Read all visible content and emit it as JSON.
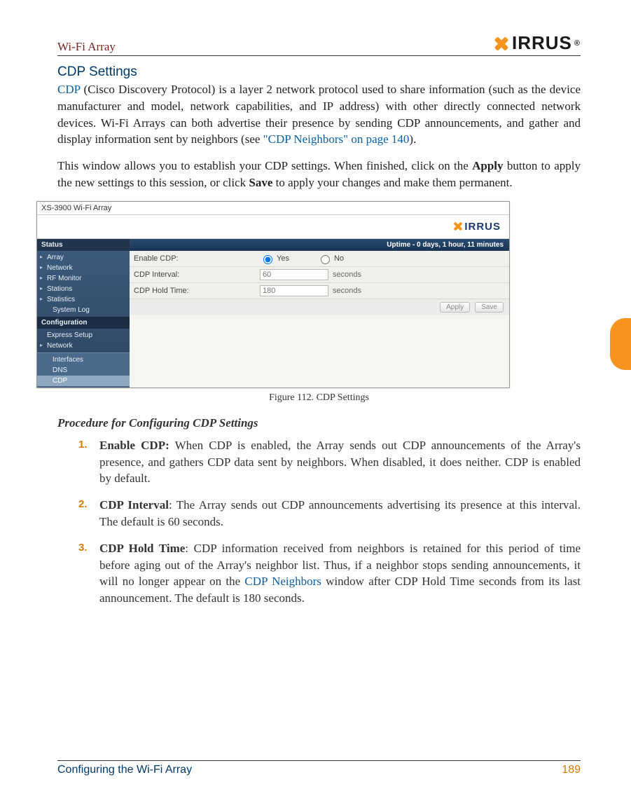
{
  "header": {
    "left": "Wi-Fi Array",
    "logo_text": "IRRUS",
    "logo_reg": "®"
  },
  "section_title": "CDP Settings",
  "p1": {
    "acronym": "CDP",
    "text1": " (Cisco Discovery Protocol) is a layer 2 network protocol used to share information (such as the device manufacturer and model, network capabilities, and IP address) with other directly connected network devices. Wi-Fi Arrays can both advertise their presence by sending CDP announcements, and gather and display information sent by neighbors (see ",
    "link": "\"CDP Neighbors\" on page 140",
    "text2": ")."
  },
  "p2": {
    "t1": "This window allows you to establish your CDP settings. When finished, click on the ",
    "b1": "Apply",
    "t2": " button to apply the new settings to this session, or click ",
    "b2": "Save",
    "t3": " to apply your changes and make them permanent."
  },
  "figure_caption": "Figure 112. CDP Settings",
  "procedure_title": "Procedure for Configuring CDP Settings",
  "steps": [
    {
      "num": "1.",
      "title": "Enable CDP:",
      "body": " When CDP is enabled, the Array sends out CDP announcements of the Array's presence, and gathers CDP data sent by neighbors. When disabled, it does neither. CDP is enabled by default."
    },
    {
      "num": "2.",
      "title": "CDP Interval",
      "body": ": The Array sends out CDP announcements advertising its presence at this interval. The default is 60 seconds."
    },
    {
      "num": "3.",
      "title": "CDP Hold Time",
      "body_pre": ": CDP information received from neighbors is retained for this period of time before aging out of the Array's neighbor list. Thus, if a neighbor stops sending announcements, it will no longer appear on the ",
      "link": "CDP Neighbors",
      "body_post": " window after CDP Hold Time seconds from its last announcement. The default is 180 seconds."
    }
  ],
  "footer": {
    "left": "Configuring the Wi-Fi Array",
    "page": "189"
  },
  "screenshot": {
    "titlebar": "XS-3900 Wi-Fi Array",
    "mini_logo": "IRRUS",
    "status_label": "Status",
    "uptime": "Uptime - 0 days, 1 hour, 11 minutes",
    "nav": [
      "Array",
      "Network",
      "RF Monitor",
      "Stations",
      "Statistics"
    ],
    "nav_syslog": "System Log",
    "config_label": "Configuration",
    "config_items": [
      "Express Setup",
      "Network"
    ],
    "sub_items": [
      "Interfaces",
      "DNS",
      "CDP"
    ],
    "row1": {
      "label": "Enable CDP:",
      "yes": "Yes",
      "no": "No"
    },
    "row2": {
      "label": "CDP Interval:",
      "value": "60",
      "unit": "seconds"
    },
    "row3": {
      "label": "CDP Hold Time:",
      "value": "180",
      "unit": "seconds"
    },
    "btn_apply": "Apply",
    "btn_save": "Save"
  },
  "chart_data": {
    "type": "table",
    "title": "CDP Settings",
    "rows": [
      {
        "setting": "Enable CDP",
        "value": "Yes",
        "options": [
          "Yes",
          "No"
        ]
      },
      {
        "setting": "CDP Interval",
        "value": 60,
        "unit": "seconds"
      },
      {
        "setting": "CDP Hold Time",
        "value": 180,
        "unit": "seconds"
      }
    ]
  }
}
